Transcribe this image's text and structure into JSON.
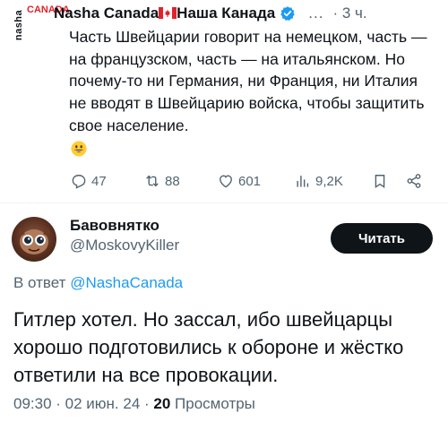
{
  "parent_tweet": {
    "logo_text": "nasha",
    "logo_text2": "CANADA",
    "author_name_a": "Nasha Canada",
    "author_name_b": "Наша Канада",
    "more_label": "...",
    "time": "· 3 ч.",
    "text": "Часть Швейцарии говорит на немецком, часть — на французском, часть — на итальянском. Но почему-то ни Германия, ни Франция, ни Италия не вводят в Швейцарию войска, чтобы защитить свое население.",
    "emoji": "grinning-face",
    "stats": {
      "replies": "47",
      "reposts": "88",
      "likes": "601",
      "views": "9,2K"
    }
  },
  "reply_tweet": {
    "author_name": "Бавовнятко",
    "author_handle": "@MoskovyKiller",
    "follow_label": "Читать",
    "in_reply_prefix": "В ответ",
    "in_reply_mention": "@NashaCanada",
    "text": "Гитлер хотел. Но зассал, ибо швейцарцы хорошо подготовились к обороне и жёстко ответили на все провокации.",
    "timestamp": "09:30 · 02 июн. 24 ·",
    "views_count": "20",
    "views_label": "Просмотры"
  },
  "colors": {
    "text": "#0f1419",
    "secondary": "#536471",
    "accent": "#1d9bf0",
    "follow_bg": "#0f1419",
    "logo_red": "#e2222a",
    "verified": "#1d9bf0"
  }
}
